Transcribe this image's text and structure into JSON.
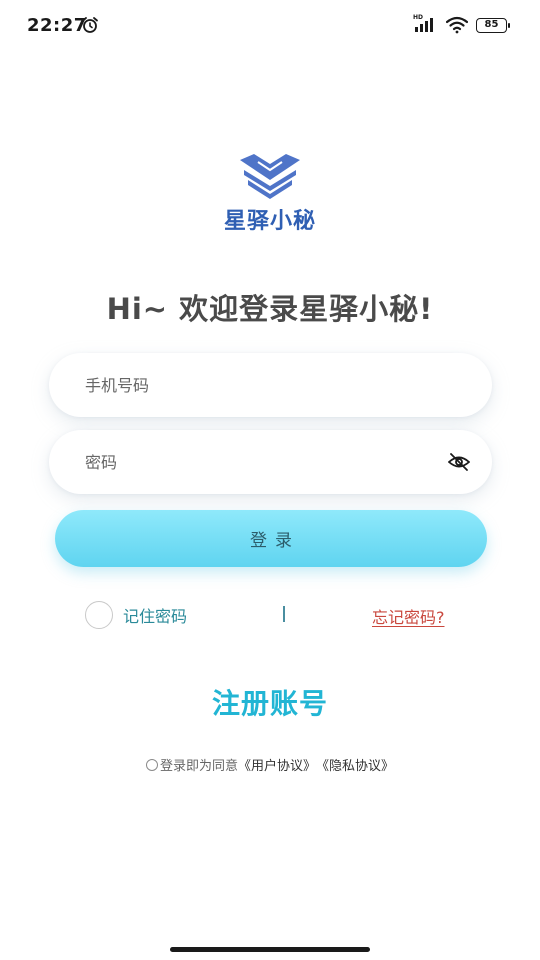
{
  "status_bar": {
    "time": "22:27",
    "network_label": "HD",
    "battery": "85"
  },
  "app": {
    "name": "星驿小秘",
    "welcome": "Hi~ 欢迎登录星驿小秘!",
    "brand_color": "#2f5fb3"
  },
  "form": {
    "phone_placeholder": "手机号码",
    "password_placeholder": "密码",
    "login_label": "登录",
    "remember_label": "记住密码",
    "separator": "|",
    "forgot_label": "忘记密码?"
  },
  "register": {
    "label": "注册账号"
  },
  "agreement": {
    "prefix": "登录即为同意",
    "user_agreement": "《用户协议》",
    "privacy_policy": "《隐私协议》"
  },
  "colors": {
    "login_gradient_top": "#8fe9fb",
    "login_gradient_bottom": "#5fd4f0",
    "register": "#22b5d4",
    "forgot": "#c9473d",
    "remember": "#2a8a99"
  },
  "icons": {
    "alarm": "alarm-clock-icon",
    "signal": "cellular-signal-icon",
    "wifi": "wifi-icon",
    "battery": "battery-icon",
    "logo": "chevron-stack-logo",
    "eye": "eye-off-icon"
  }
}
